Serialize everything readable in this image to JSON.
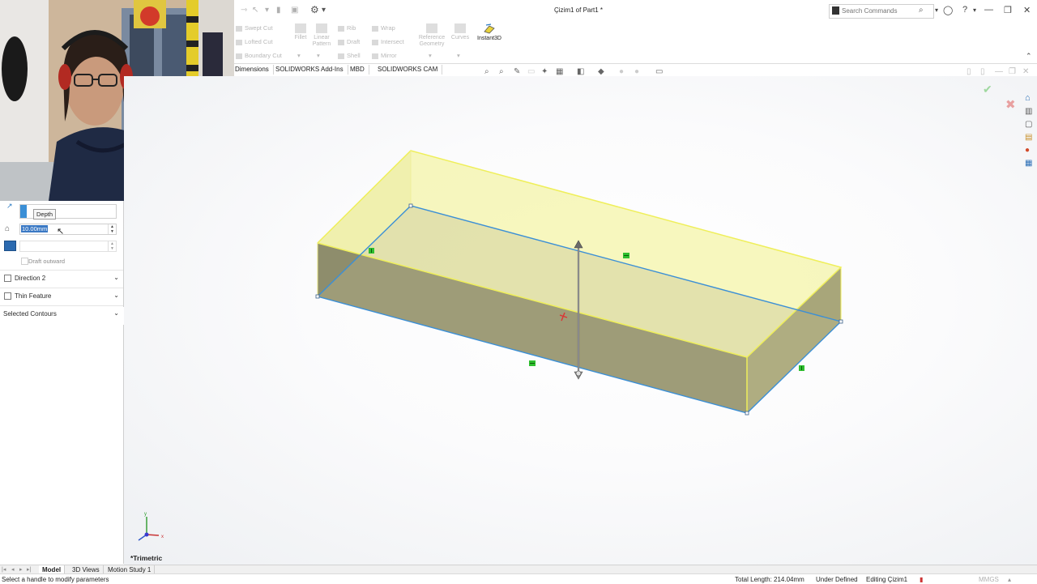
{
  "window": {
    "doc_title": "Çizim1 of Part1 *",
    "search_placeholder": "Search Commands"
  },
  "ribbon": {
    "swept_cut": "Swept Cut",
    "lofted_cut": "Lofted Cut",
    "boundary_cut": "Boundary Cut",
    "fillet": "Fillet",
    "linear_pattern": "Linear Pattern",
    "rib": "Rib",
    "draft": "Draft",
    "shell": "Shell",
    "wrap": "Wrap",
    "intersect": "Intersect",
    "mirror": "Mirror",
    "reference_geometry": "Reference Geometry",
    "curves": "Curves",
    "instant3d": "Instant3D"
  },
  "command_tabs": [
    "Dimensions",
    "SOLIDWORKS Add-Ins",
    "MBD",
    "SOLIDWORKS CAM"
  ],
  "property_manager": {
    "depth_tooltip": "Depth",
    "depth_value": "10.00mm",
    "draft_outward": "Draft outward",
    "direction2": "Direction 2",
    "thin_feature": "Thin Feature",
    "selected_contours": "Selected Contours"
  },
  "viewport": {
    "view_name": "*Trimetric"
  },
  "bottom_tabs": [
    "Model",
    "3D Views",
    "Motion Study 1"
  ],
  "status": {
    "hint": "Select a handle to modify parameters",
    "total_length": "Total Length: 214.04mm",
    "definition": "Under Defined",
    "editing": "Editing Çizim1",
    "units": "MMGS"
  },
  "colors": {
    "accent_blue": "#3b8fd6",
    "preview_yellow": "#f2f29a",
    "handle_green": "#2fbf2f"
  }
}
